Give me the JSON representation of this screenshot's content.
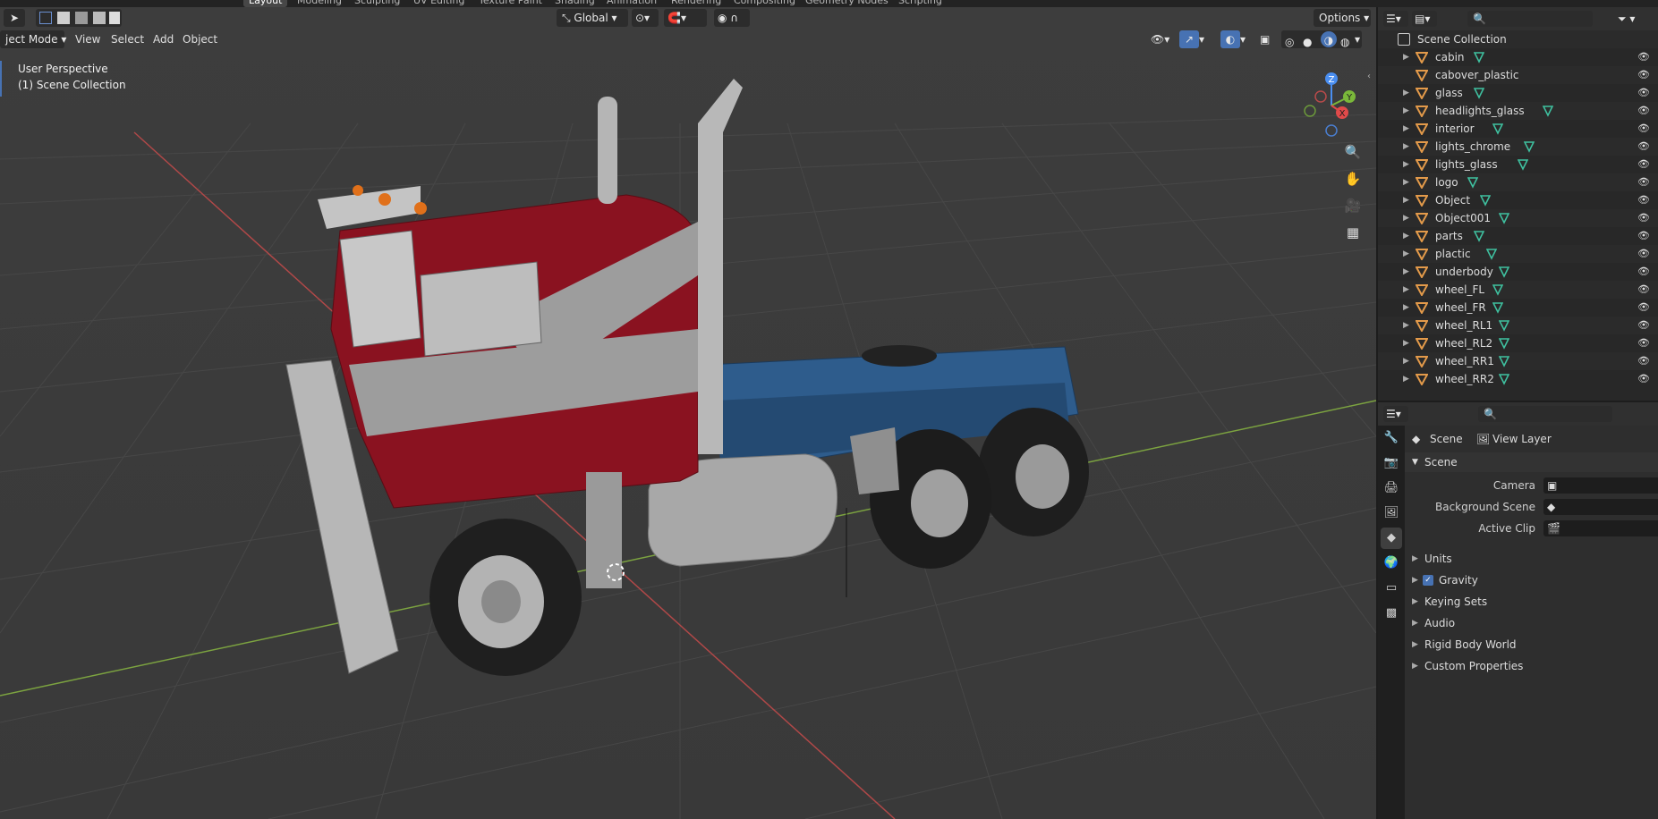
{
  "workspace_tabs": [
    "Layout",
    "Modeling",
    "Sculpting",
    "UV Editing",
    "Texture Paint",
    "Shading",
    "Animation",
    "Rendering",
    "Compositing",
    "Geometry Nodes",
    "Scripting"
  ],
  "viewport": {
    "mode": "ject Mode",
    "menus": [
      "View",
      "Select",
      "Add",
      "Object"
    ],
    "transform_orientation": "Global",
    "options_label": "Options",
    "overlay_line1": "User Perspective",
    "overlay_line2": "(1) Scene Collection",
    "gizmo": {
      "z": "Z",
      "y": "Y",
      "x": "X"
    }
  },
  "outliner": {
    "root": "Scene Collection",
    "items": [
      {
        "name": "cabin",
        "expand": true
      },
      {
        "name": "cabover_plastic",
        "expand": false
      },
      {
        "name": "glass",
        "expand": true
      },
      {
        "name": "headlights_glass",
        "expand": true
      },
      {
        "name": "interior",
        "expand": true
      },
      {
        "name": "lights_chrome",
        "expand": true
      },
      {
        "name": "lights_glass",
        "expand": true
      },
      {
        "name": "logo",
        "expand": true
      },
      {
        "name": "Object",
        "expand": true
      },
      {
        "name": "Object001",
        "expand": true
      },
      {
        "name": "parts",
        "expand": true
      },
      {
        "name": "plactic",
        "expand": true
      },
      {
        "name": "underbody",
        "expand": true
      },
      {
        "name": "wheel_FL",
        "expand": true
      },
      {
        "name": "wheel_FR",
        "expand": true
      },
      {
        "name": "wheel_RL1",
        "expand": true
      },
      {
        "name": "wheel_RL2",
        "expand": true
      },
      {
        "name": "wheel_RR1",
        "expand": true
      },
      {
        "name": "wheel_RR2",
        "expand": true
      }
    ]
  },
  "properties": {
    "breadcrumb_scene": "Scene",
    "breadcrumb_layer": "View Layer",
    "section_scene": "Scene",
    "fields": [
      {
        "label": "Camera"
      },
      {
        "label": "Background Scene"
      },
      {
        "label": "Active Clip"
      }
    ],
    "panels": [
      "Units",
      "Gravity",
      "Keying Sets",
      "Audio",
      "Rigid Body World",
      "Custom Properties"
    ],
    "gravity_checked": true
  },
  "colors": {
    "accent": "#4772b3",
    "truck_red": "#8a1220",
    "truck_blue": "#2e5c8c",
    "mesh_icon": "#e39a4a",
    "data_icon": "#3fc1a0"
  }
}
